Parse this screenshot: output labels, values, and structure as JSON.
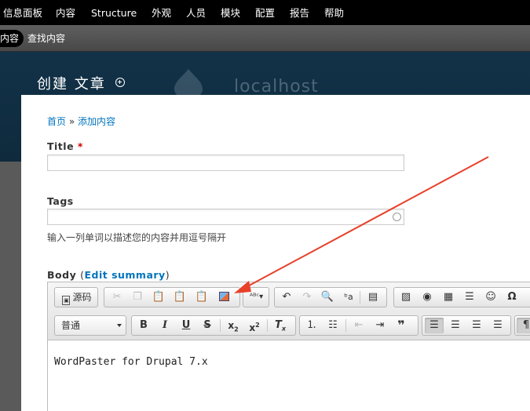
{
  "admin_menu": [
    "信息面板",
    "内容",
    "Structure",
    "外观",
    "人员",
    "模块",
    "配置",
    "报告",
    "帮助"
  ],
  "shortcuts": [
    "内容",
    "查找内容"
  ],
  "overlay": {
    "title": "创建 文章",
    "site_name": "localhost"
  },
  "breadcrumb": {
    "home": "首页",
    "separator": "»",
    "current": "添加内容"
  },
  "fields": {
    "title": {
      "label": "Title",
      "required_mark": "*",
      "value": ""
    },
    "tags": {
      "label": "Tags",
      "value": "",
      "description": "输入一列单词以描述您的内容并用逗号隔开"
    },
    "body": {
      "label": "Body",
      "open_paren": "(",
      "edit_summary": "Edit summary",
      "close_paren": ")"
    }
  },
  "editor": {
    "source_label": "源码",
    "format_value": "普通",
    "content": "WordPaster for Drupal 7.x",
    "icons_row1": [
      "source-icon",
      "cut-icon",
      "copy-icon",
      "paste-icon",
      "paste-text-icon",
      "paste-word-icon",
      "wordpaster-icon",
      "spellcheck-icon",
      "undo-icon",
      "redo-icon",
      "find-icon",
      "replace-icon",
      "select-all-icon",
      "image-icon",
      "flash-icon",
      "table-icon",
      "horizontal-rule-icon",
      "smiley-icon",
      "special-char-icon"
    ],
    "icons_row2": [
      "bold-icon",
      "italic-icon",
      "underline-icon",
      "strike-icon",
      "subscript-icon",
      "superscript-icon",
      "remove-format-icon",
      "numbered-list-icon",
      "bulleted-list-icon",
      "outdent-icon",
      "indent-icon",
      "blockquote-icon",
      "align-left-icon",
      "align-center-icon",
      "align-right-icon",
      "justify-icon",
      "bidi-ltr-icon"
    ]
  },
  "colors": {
    "admin_bar": "#000000",
    "link": "#0074bd",
    "annotation_arrow": "#e8402a",
    "header_bg": "#123248"
  }
}
